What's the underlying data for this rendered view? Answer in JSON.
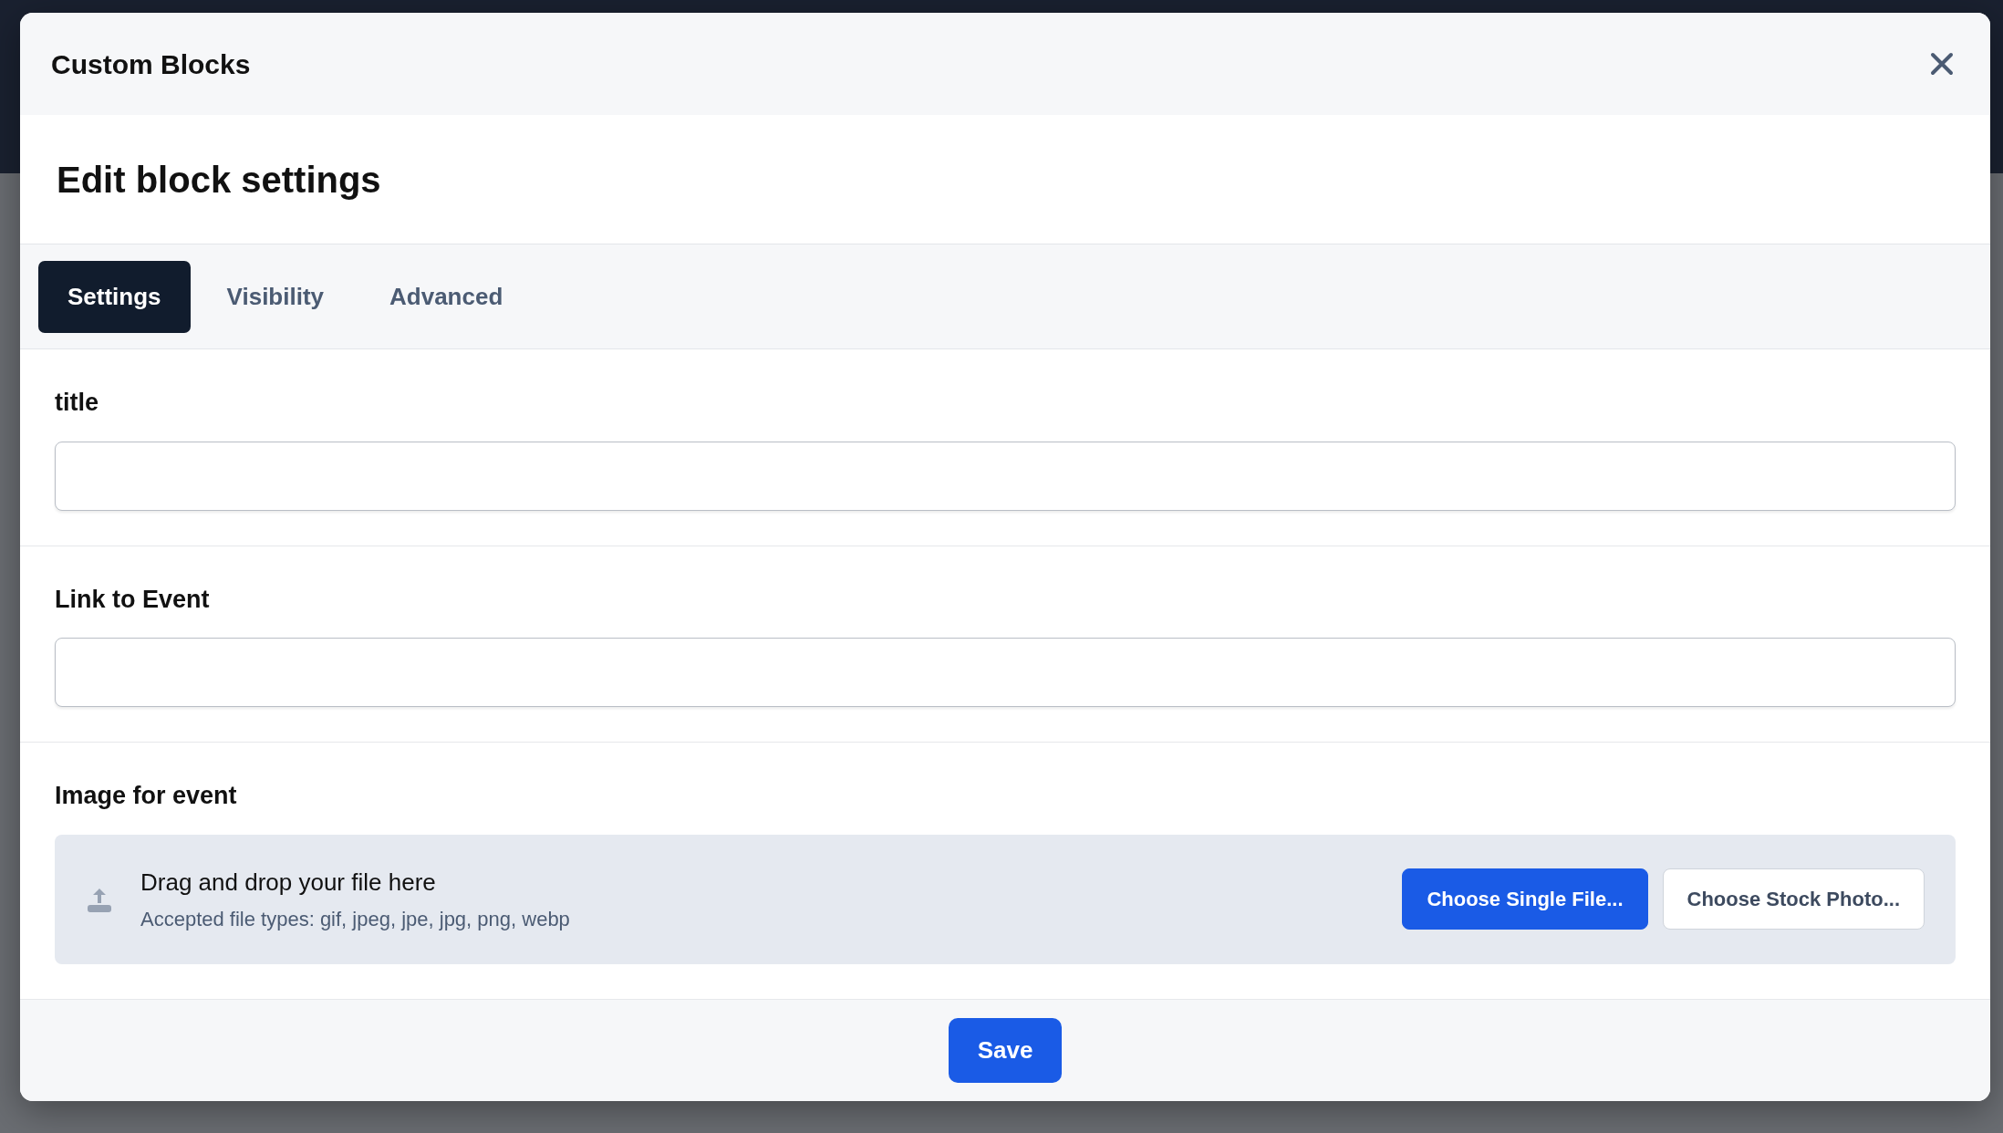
{
  "dialog": {
    "title": "Custom Blocks",
    "heading": "Edit block settings"
  },
  "tabs": [
    {
      "label": "Settings",
      "selected": true
    },
    {
      "label": "Visibility",
      "selected": false
    },
    {
      "label": "Advanced",
      "selected": false
    }
  ],
  "fields": [
    {
      "kind": "text",
      "label": "title"
    },
    {
      "kind": "text",
      "label": "Link to Event"
    },
    {
      "kind": "upload",
      "label": "Image for event",
      "prompt": "Drag and drop your file here",
      "hint": "Accepted file types: gif, jpeg, jpe, jpg, png, webp",
      "buttons": [
        {
          "label": "Choose Single File...",
          "primary": true
        },
        {
          "label": "Choose Stock Photo...",
          "primary": false
        }
      ]
    }
  ],
  "footer": {
    "save": "Save"
  }
}
